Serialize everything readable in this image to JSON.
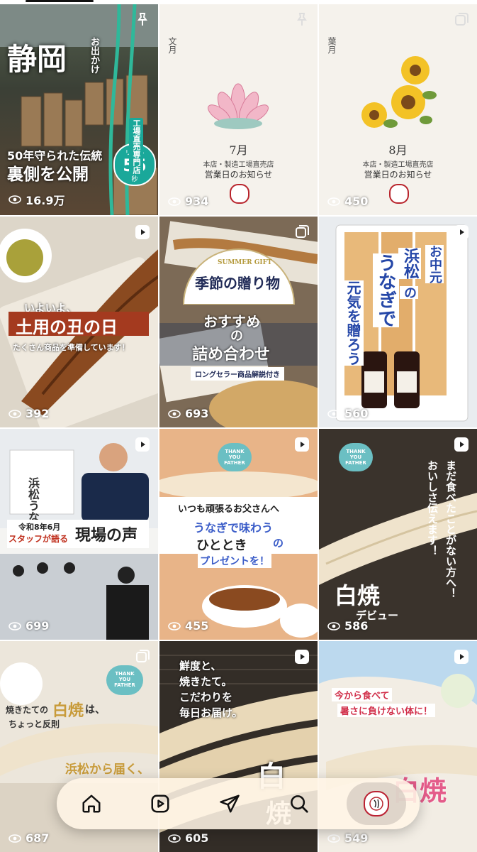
{
  "grid": {
    "posts": [
      {
        "views": "16.9万",
        "t1": "静岡",
        "t2": "お出かけ",
        "t3": "50年守られた伝統",
        "t4": "裏側を公開",
        "t5": "工場直売専門店",
        "t6": "リール",
        "t7": "55",
        "t8": "秒",
        "badge": "pin-icon"
      },
      {
        "views": "934",
        "month_name": "文月",
        "month": "7月",
        "line1": "本店・製造工場直売店",
        "line2": "営業日のお知らせ",
        "badge": "pin-icon"
      },
      {
        "views": "450",
        "month_name": "葉月",
        "month": "8月",
        "line1": "本店・製造工場直売店",
        "line2": "営業日のお知らせ",
        "badge": "carousel-icon"
      },
      {
        "views": "392",
        "t1": "いよいよ、",
        "t2": "土用の丑の日",
        "t3": "たくさん商品を準備しています！",
        "badge": "reel-icon"
      },
      {
        "views": "693",
        "t1": "SUMMER GIFT",
        "t2": "季節の贈り物",
        "t3": "おすすめ",
        "t4": "の",
        "t5": "詰め合わせ",
        "t6": "ロングセラー商品解説付き",
        "badge": "carousel-icon"
      },
      {
        "views": "560",
        "t1": "お中元",
        "t2": "浜松",
        "t3": "の",
        "t4": "うなぎで",
        "t5": "元気を贈ろう",
        "badge": "reel-icon"
      },
      {
        "views": "699",
        "t1": "令和8年6月",
        "t2": "スタッフが語る",
        "t3": "現場の声",
        "badge": "reel-icon"
      },
      {
        "views": "455",
        "t1": "THANK YOU FATHER",
        "t2": "いつも頑張るお父さんへ",
        "t3": "うなぎで味わう",
        "t4": "ひととき",
        "t5": "の",
        "t6": "プレゼントを！",
        "badge": "reel-icon"
      },
      {
        "views": "586",
        "t1": "THANK YOU FATHER",
        "t2": "まだ食べたことがない方へ！",
        "t3": "おいしさ伝えます！",
        "t4": "白焼",
        "t5": "デビュー",
        "badge": "reel-icon"
      },
      {
        "views": "687",
        "t1": "THANK YOU FATHER",
        "t2": "焼きたての",
        "t3": "白焼",
        "t4": "は、",
        "t5": "ちょっと反則",
        "t6": "浜松から届く、",
        "badge": "carousel-icon"
      },
      {
        "views": "605",
        "t1": "鮮度と、",
        "t2": "焼きたて。",
        "t3": "こだわりを",
        "t4": "毎日お届け。",
        "t5": "白",
        "t6": "焼",
        "badge": "reel-icon"
      },
      {
        "views": "549",
        "t1": "今から食べて",
        "t2": "暑さに負けない体に！",
        "t3": "白焼",
        "badge": "reel-icon"
      }
    ]
  },
  "nav": {
    "items": [
      "home-icon",
      "reels-icon",
      "send-icon",
      "search-icon",
      "profile-avatar"
    ],
    "active": "profile-avatar"
  },
  "colors": {
    "accent": "#b8242c",
    "eel": "#8a4a20",
    "cream": "#f6f2ea"
  }
}
